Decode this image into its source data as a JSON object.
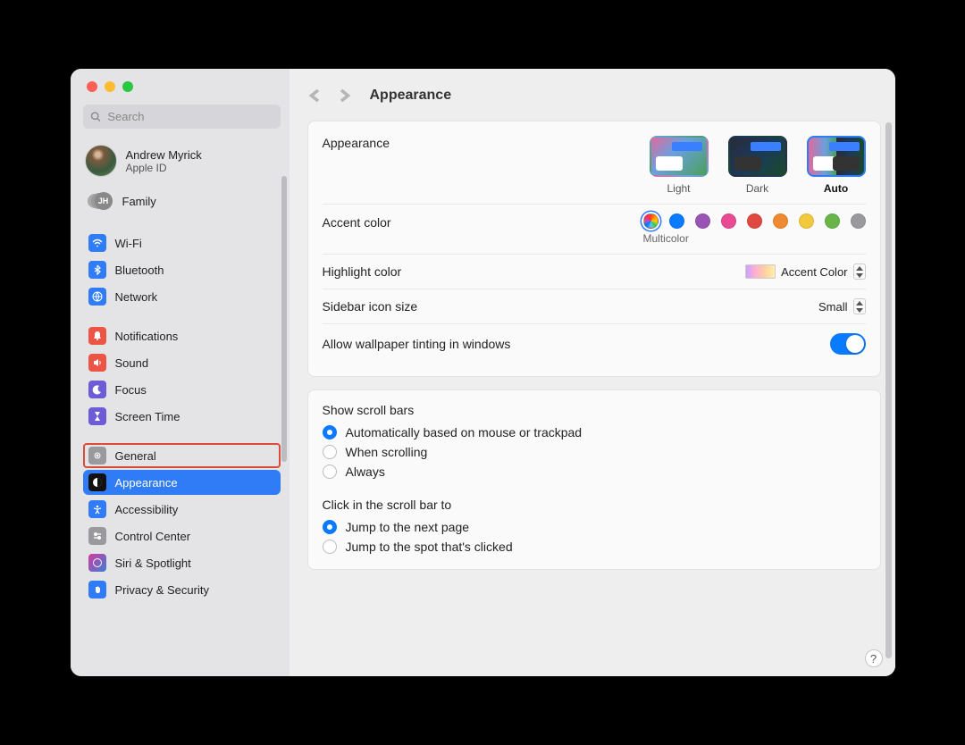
{
  "search": {
    "placeholder": "Search"
  },
  "user": {
    "name": "Andrew Myrick",
    "sub": "Apple ID"
  },
  "family": {
    "label": "Family",
    "badge": "JH"
  },
  "sidebar": {
    "wifi": "Wi-Fi",
    "bluetooth": "Bluetooth",
    "network": "Network",
    "notifications": "Notifications",
    "sound": "Sound",
    "focus": "Focus",
    "screentime": "Screen Time",
    "general": "General",
    "appearance": "Appearance",
    "accessibility": "Accessibility",
    "controlcenter": "Control Center",
    "siri": "Siri & Spotlight",
    "privacy": "Privacy & Security"
  },
  "title": "Appearance",
  "appearance": {
    "label": "Appearance",
    "light": "Light",
    "dark": "Dark",
    "auto": "Auto",
    "selected": "Auto"
  },
  "accent": {
    "label": "Accent color",
    "selected_label": "Multicolor",
    "colors": [
      "multicolor",
      "blue",
      "purple",
      "pink",
      "red",
      "orange",
      "yellow",
      "green",
      "graphite"
    ]
  },
  "highlight": {
    "label": "Highlight color",
    "value": "Accent Color"
  },
  "sidebar_icon": {
    "label": "Sidebar icon size",
    "value": "Small"
  },
  "tinting": {
    "label": "Allow wallpaper tinting in windows",
    "enabled": true
  },
  "scrollbars": {
    "label": "Show scroll bars",
    "opt_auto": "Automatically based on mouse or trackpad",
    "opt_scroll": "When scrolling",
    "opt_always": "Always",
    "selected": "auto"
  },
  "click_scroll": {
    "label": "Click in the scroll bar to",
    "opt_next": "Jump to the next page",
    "opt_spot": "Jump to the spot that's clicked",
    "selected": "next"
  },
  "help": "?"
}
